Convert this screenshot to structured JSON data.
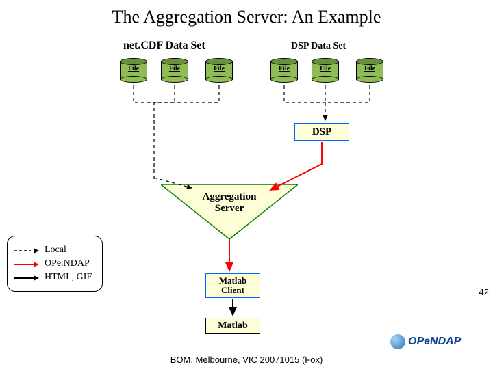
{
  "title": "The Aggregation Server: An Example",
  "datasets": {
    "left_label": "net.CDF Data Set",
    "right_label": "DSP Data Set",
    "file_label": "File"
  },
  "boxes": {
    "dsp": "DSP",
    "agg_line1": "Aggregation",
    "agg_line2": "Server",
    "matlab_client_line1": "Matlab",
    "matlab_client_line2": "Client",
    "matlab": "Matlab"
  },
  "legend": {
    "local": "Local",
    "opendap": "OPe.NDAP",
    "htmlgif": "HTML, GIF"
  },
  "footer": "BOM, Melbourne, VIC 20071015 (Fox)",
  "logo_text": "OPeNDAP",
  "page_number": "42"
}
